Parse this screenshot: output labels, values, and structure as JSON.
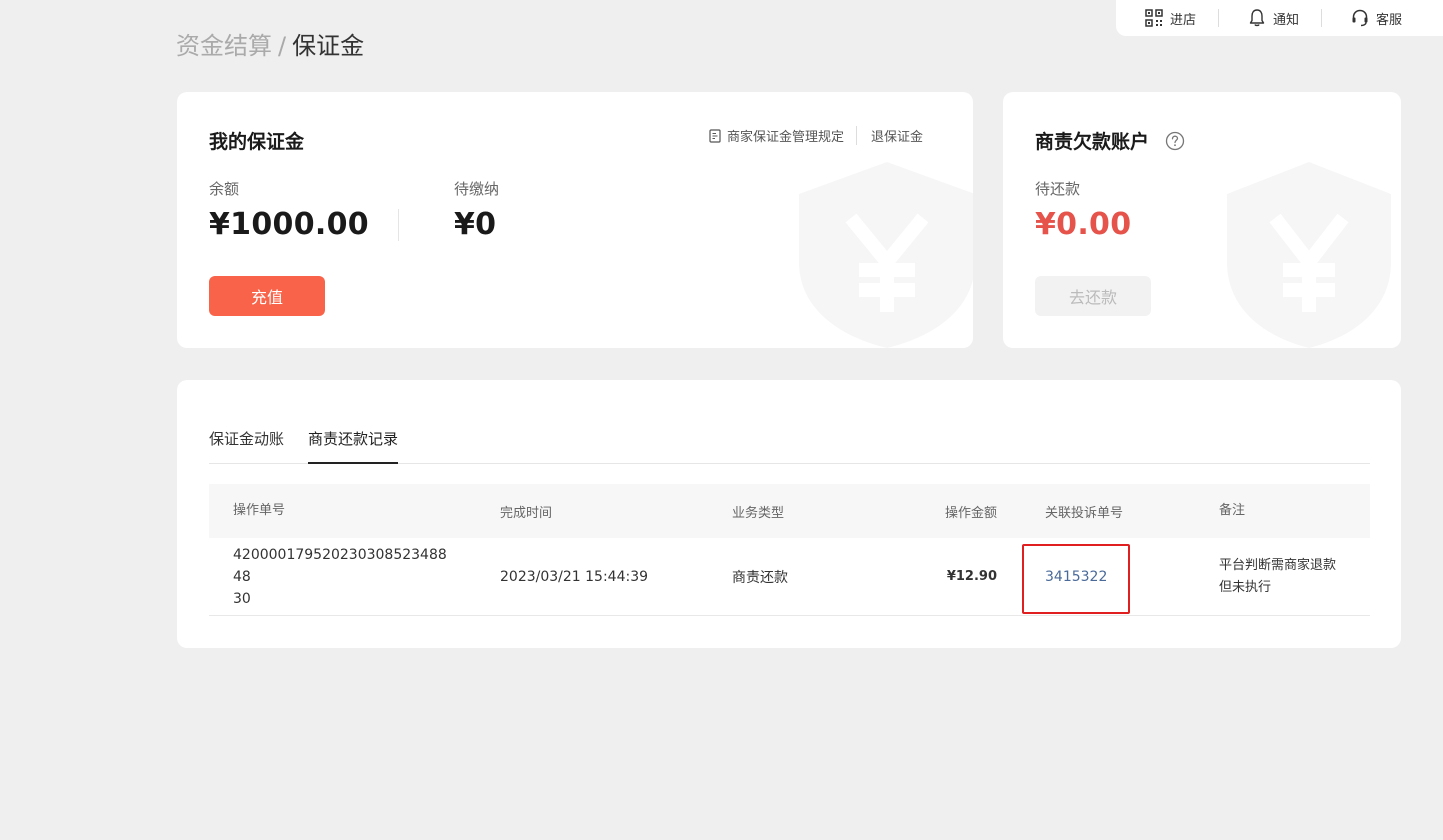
{
  "topbar": {
    "items": [
      {
        "label": "进店",
        "icon": "qrcode-icon"
      },
      {
        "label": "通知",
        "icon": "bell-icon"
      },
      {
        "label": "客服",
        "icon": "headset-icon"
      }
    ]
  },
  "breadcrumb": {
    "parent": "资金结算",
    "separator": "/",
    "current": "保证金"
  },
  "deposit": {
    "title": "我的保证金",
    "rule_link": "商家保证金管理规定",
    "refund_link": "退保证金",
    "balance_label": "余额",
    "balance_value": "¥1000.00",
    "pending_label": "待缴纳",
    "pending_value": "¥0",
    "recharge_button": "充值"
  },
  "debt": {
    "title": "商责欠款账户",
    "due_label": "待还款",
    "due_value": "¥0.00",
    "repay_button": "去还款"
  },
  "records": {
    "tabs": [
      {
        "label": "保证金动账",
        "active": false
      },
      {
        "label": "商责还款记录",
        "active": true
      }
    ],
    "columns": [
      "操作单号",
      "完成时间",
      "业务类型",
      "操作金额",
      "关联投诉单号",
      "备注"
    ],
    "rows": [
      {
        "order_no": "4200001795202303085234884830",
        "order_no_line1": "420000179520230308523488​48",
        "order_no_line2": "30",
        "time": "2023/03/21 15:44:39",
        "type": "商责还款",
        "amount": "¥12.90",
        "complaint_no": "3415322",
        "remark_line1": "平台判断需商家退款",
        "remark_line2": "但未执行"
      }
    ]
  },
  "colors": {
    "accent": "#f9634a",
    "debt_red": "#e5534b",
    "link_blue": "#4a6a99",
    "highlight_red": "#e02020"
  }
}
